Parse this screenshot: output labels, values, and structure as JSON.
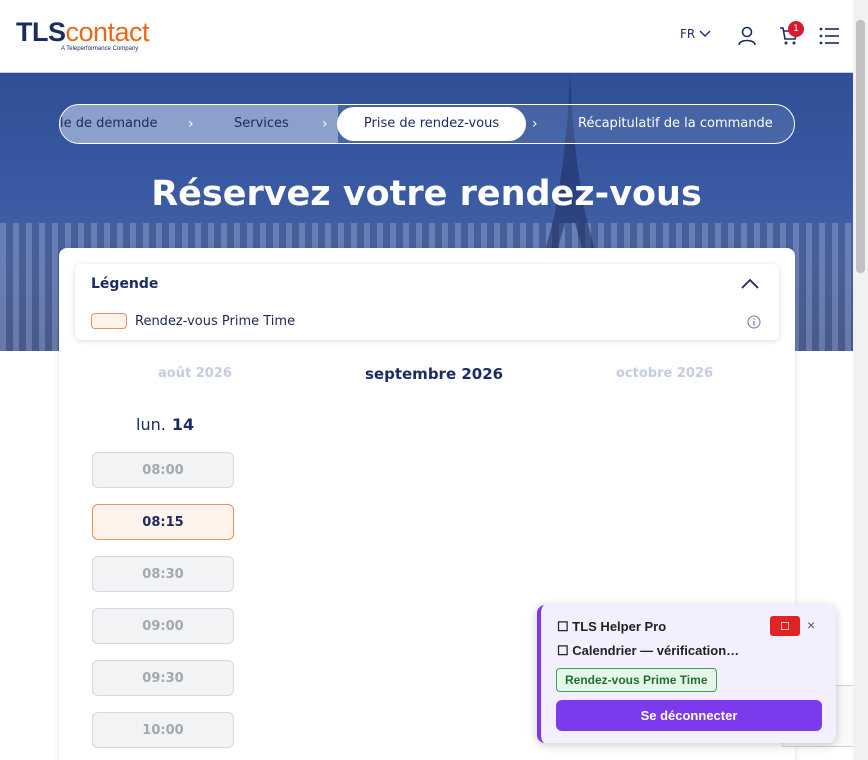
{
  "header": {
    "logo_tls": "TLS",
    "logo_contact": "contact",
    "logo_tagline": "A Teleperformance Company",
    "language": "FR",
    "cart_count": "1"
  },
  "hero": {
    "steps": [
      {
        "label": "le de demande"
      },
      {
        "label": "Services"
      },
      {
        "label": "Prise de rendez-vous"
      },
      {
        "label": "Récapitulatif de la commande"
      }
    ],
    "step_separator": "›",
    "title": "Réservez votre rendez-vous"
  },
  "legend": {
    "title": "Légende",
    "prime_label": "Rendez-vous Prime Time"
  },
  "calendar": {
    "prev_month": "août 2026",
    "current_month": "septembre 2026",
    "next_month": "octobre 2026",
    "day_name": "lun.",
    "day_number": "14",
    "slots": [
      {
        "time": "08:00",
        "prime": false
      },
      {
        "time": "08:15",
        "prime": true
      },
      {
        "time": "08:30",
        "prime": false
      },
      {
        "time": "09:00",
        "prime": false
      },
      {
        "time": "09:30",
        "prime": false
      },
      {
        "time": "10:00",
        "prime": false
      }
    ]
  },
  "helper": {
    "title": "☐ TLS Helper Pro",
    "stop_glyph": "☐",
    "close_glyph": "×",
    "status": "☐ Calendrier — vérification…",
    "badge": "Rendez-vous Prime Time",
    "logout_label": "Se déconnecter"
  },
  "colors": {
    "brand_navy": "#1d2b64",
    "brand_orange": "#e56a1c",
    "prime_border": "#e8915a",
    "helper_purple": "#7c3aed",
    "badge_red": "#d81b2b"
  }
}
